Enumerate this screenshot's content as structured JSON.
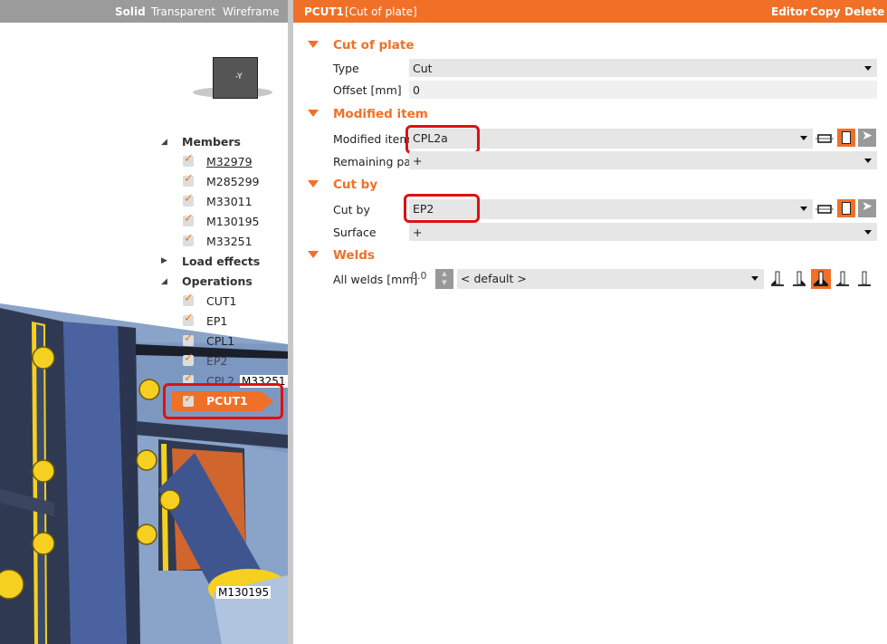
{
  "viewport": {
    "modes": [
      "Solid",
      "Transparent",
      "Wireframe"
    ],
    "active_mode": "Solid",
    "view_cube_label": "-Y",
    "labels": [
      "M33251",
      "M130195"
    ]
  },
  "tree": {
    "members": {
      "label": "Members",
      "items": [
        "M32979",
        "M285299",
        "M33011",
        "M130195",
        "M33251"
      ]
    },
    "load_effects": {
      "label": "Load effects"
    },
    "operations": {
      "label": "Operations",
      "items": [
        "CUT1",
        "EP1",
        "CPL1",
        "EP2",
        "CPL2",
        "PCUT1"
      ],
      "selected": "PCUT1"
    }
  },
  "header": {
    "name": "PCUT1",
    "type": "[Cut of plate]",
    "actions": [
      "Editor",
      "Copy",
      "Delete"
    ]
  },
  "sections": {
    "cut_of_plate": {
      "title": "Cut of plate",
      "type_label": "Type",
      "type_value": "Cut",
      "offset_label": "Offset [mm]",
      "offset_value": "0"
    },
    "modified_item": {
      "title": "Modified item",
      "item_label": "Modified item",
      "item_value": "CPL2a",
      "remaining_label": "Remaining part",
      "remaining_value": "+"
    },
    "cut_by": {
      "title": "Cut by",
      "cutby_label": "Cut by",
      "cutby_value": "EP2",
      "surface_label": "Surface",
      "surface_value": "+"
    },
    "welds": {
      "title": "Welds",
      "all_label": "All welds [mm]",
      "all_value": "0.0",
      "type_value": "< default >"
    }
  },
  "colors": {
    "accent": "#f07028",
    "highlight": "#e01010"
  }
}
